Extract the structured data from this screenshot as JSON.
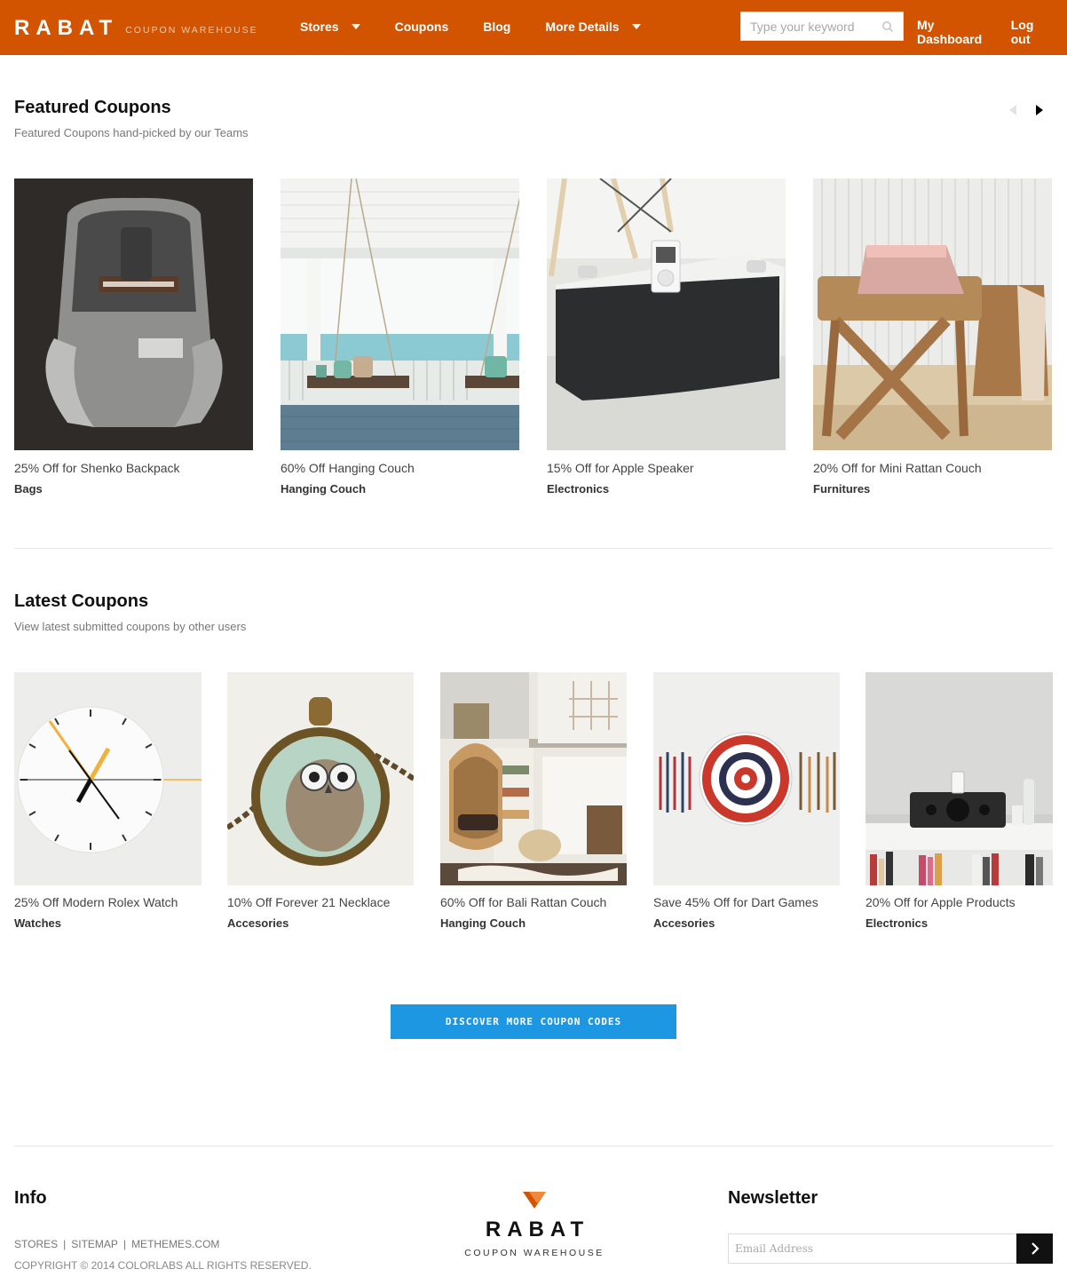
{
  "header": {
    "logo_word": "RABAT",
    "logo_tagline": "COUPON WAREHOUSE",
    "nav": [
      {
        "label": "Stores",
        "has_dropdown": true
      },
      {
        "label": "Coupons",
        "has_dropdown": false
      },
      {
        "label": "Blog",
        "has_dropdown": false
      },
      {
        "label": "More Details",
        "has_dropdown": true
      }
    ],
    "search_placeholder": "Type your keyword",
    "dashboard_label": "My Dashboard",
    "logout_label": "Log out"
  },
  "featured": {
    "title": "Featured Coupons",
    "subtitle": "Featured Coupons hand-picked by our Teams",
    "items": [
      {
        "title": "25% Off for Shenko Backpack",
        "category": "Bags",
        "image": "backpack"
      },
      {
        "title": "60% Off Hanging Couch",
        "category": "Hanging Couch",
        "image": "porch-swing"
      },
      {
        "title": "15% Off for Apple Speaker",
        "category": "Electronics",
        "image": "speaker-dock"
      },
      {
        "title": "20% Off for Mini Rattan Couch",
        "category": "Furnitures",
        "image": "rattan-stool"
      }
    ]
  },
  "latest": {
    "title": "Latest Coupons",
    "subtitle": "View latest submitted coupons by other users",
    "items": [
      {
        "title": "25% Off Modern Rolex Watch",
        "category": "Watches",
        "image": "wall-clock"
      },
      {
        "title": "10% Off Forever 21 Necklace",
        "category": "Accesories",
        "image": "owl-pendant"
      },
      {
        "title": "60% Off for Bali Rattan Couch",
        "category": "Hanging Couch",
        "image": "rattan-chair-room"
      },
      {
        "title": "Save 45% Off for Dart Games",
        "category": "Accesories",
        "image": "dartboard"
      },
      {
        "title": "20% Off for Apple Products",
        "category": "Electronics",
        "image": "ipod-dock-shelf"
      }
    ]
  },
  "discover_label": "DISCOVER MORE COUPON CODES",
  "footer": {
    "info_title": "Info",
    "links": [
      "STORES",
      "SITEMAP",
      "METHEMES.COM"
    ],
    "copyright": "COPYRIGHT © 2014 COLORLABS ALL RIGHTS RESERVED.",
    "logo_word": "RABAT",
    "logo_tagline": "COUPON WAREHOUSE",
    "newsletter_title": "Newsletter",
    "email_placeholder": "Email Address"
  },
  "colors": {
    "brand": "#d35400",
    "button": "#1e97e3"
  }
}
